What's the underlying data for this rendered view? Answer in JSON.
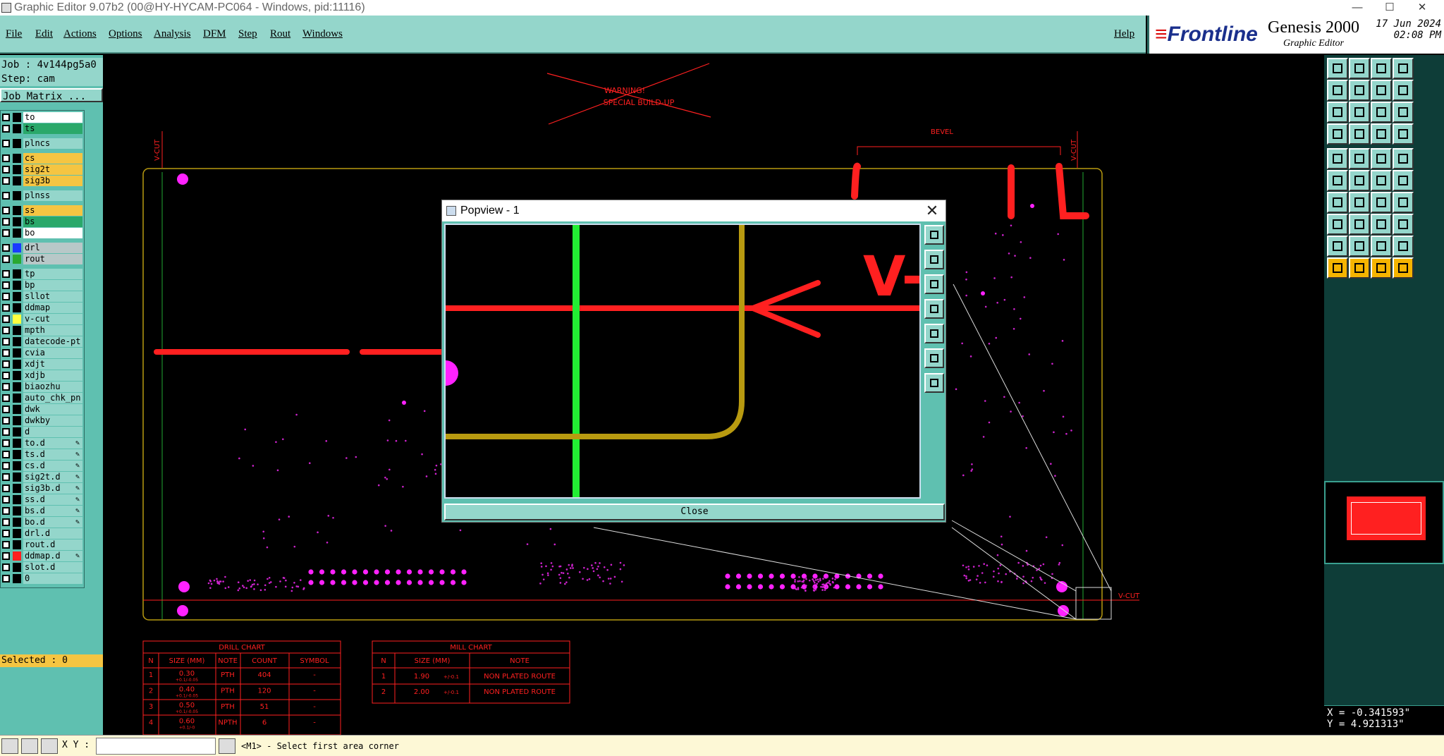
{
  "window": {
    "title": "Graphic Editor 9.07b2 (00@HY-HYCAM-PC064 - Windows, pid:11116)",
    "min": "—",
    "max": "☐",
    "close": "✕"
  },
  "menu": [
    "File",
    "Edit",
    "Actions",
    "Options",
    "Analysis",
    "DFM",
    "Step",
    "Rout",
    "Windows"
  ],
  "help": "Help",
  "brand": {
    "logo_pre": "≡",
    "logo": "Frontline",
    "product": "Genesis 2000",
    "subtitle": "Graphic Editor",
    "date": "17 Jun 2024",
    "time": "02:08 PM"
  },
  "job": {
    "job": "Job : 4v144pg5a0",
    "step": "Step: cam",
    "matrix": "Job Matrix ..."
  },
  "layers": [
    {
      "name": "to",
      "bg": "#ffffff",
      "sw": "#000000"
    },
    {
      "name": "ts",
      "bg": "#2aa86a",
      "sw": "#000000"
    },
    {
      "name": "plncs",
      "bg": "#94d6cb",
      "sw": "#000000"
    },
    {
      "name": "cs",
      "bg": "#f5c542",
      "sw": "#000000"
    },
    {
      "name": "sig2t",
      "bg": "#f5c542",
      "sw": "#000000"
    },
    {
      "name": "sig3b",
      "bg": "#f5c542",
      "sw": "#000000"
    },
    {
      "name": "plnss",
      "bg": "#94d6cb",
      "sw": "#000000"
    },
    {
      "name": "ss",
      "bg": "#f5c542",
      "sw": "#000000"
    },
    {
      "name": "bs",
      "bg": "#2aa86a",
      "sw": "#000000"
    },
    {
      "name": "bo",
      "bg": "#ffffff",
      "sw": "#000000"
    },
    {
      "name": "drl",
      "bg": "#b8c8c8",
      "sw": "#1a3cff"
    },
    {
      "name": "rout",
      "bg": "#b8c8c8",
      "sw": "#2aa830"
    },
    {
      "name": "tp",
      "bg": "#94d6cb",
      "sw": "#000000"
    },
    {
      "name": "bp",
      "bg": "#94d6cb",
      "sw": "#000000"
    },
    {
      "name": "sllot",
      "bg": "#94d6cb",
      "sw": "#000000"
    },
    {
      "name": "ddmap",
      "bg": "#94d6cb",
      "sw": "#000000"
    },
    {
      "name": "v-cut",
      "bg": "#94d6cb",
      "sw": "#ffff40"
    },
    {
      "name": "mpth",
      "bg": "#94d6cb",
      "sw": "#000000"
    },
    {
      "name": "datecode-pt",
      "bg": "#94d6cb",
      "sw": "#000000"
    },
    {
      "name": "cvia",
      "bg": "#94d6cb",
      "sw": "#000000"
    },
    {
      "name": "xdjt",
      "bg": "#94d6cb",
      "sw": "#000000"
    },
    {
      "name": "xdjb",
      "bg": "#94d6cb",
      "sw": "#000000"
    },
    {
      "name": "biaozhu",
      "bg": "#94d6cb",
      "sw": "#000000"
    },
    {
      "name": "auto_chk_pn",
      "bg": "#94d6cb",
      "sw": "#000000"
    },
    {
      "name": "dwk",
      "bg": "#94d6cb",
      "sw": "#000000"
    },
    {
      "name": "dwkby",
      "bg": "#94d6cb",
      "sw": "#000000"
    },
    {
      "name": "d",
      "bg": "#94d6cb",
      "sw": "#000000"
    },
    {
      "name": "to.d",
      "bg": "#94d6cb",
      "sw": "#000000",
      "ed": true
    },
    {
      "name": "ts.d",
      "bg": "#94d6cb",
      "sw": "#000000",
      "ed": true
    },
    {
      "name": "cs.d",
      "bg": "#94d6cb",
      "sw": "#000000",
      "ed": true
    },
    {
      "name": "sig2t.d",
      "bg": "#94d6cb",
      "sw": "#000000",
      "ed": true
    },
    {
      "name": "sig3b.d",
      "bg": "#94d6cb",
      "sw": "#000000",
      "ed": true
    },
    {
      "name": "ss.d",
      "bg": "#94d6cb",
      "sw": "#000000",
      "ed": true
    },
    {
      "name": "bs.d",
      "bg": "#94d6cb",
      "sw": "#000000",
      "ed": true
    },
    {
      "name": "bo.d",
      "bg": "#94d6cb",
      "sw": "#000000",
      "ed": true
    },
    {
      "name": "drl.d",
      "bg": "#94d6cb",
      "sw": "#000000"
    },
    {
      "name": "rout.d",
      "bg": "#94d6cb",
      "sw": "#000000"
    },
    {
      "name": "ddmap.d",
      "bg": "#94d6cb",
      "sw": "#ff2020",
      "ed": true
    },
    {
      "name": "slot.d",
      "bg": "#94d6cb",
      "sw": "#000000"
    },
    {
      "name": "0",
      "bg": "#94d6cb",
      "sw": "#000000"
    }
  ],
  "selected": "Selected : 0",
  "canvas": {
    "warning1": "WARNING!",
    "warning2": "SPECIAL BUILD-UP",
    "vcut": "V-CUT",
    "bevel": "BEVEL",
    "drill_chart": {
      "title": "DRILL CHART",
      "headers": [
        "N",
        "SIZE (MM)",
        "NOTE",
        "COUNT",
        "SYMBOL"
      ],
      "rows": [
        [
          "1",
          "0.30",
          "+0.1/-0.05",
          "PTH",
          "404",
          "-"
        ],
        [
          "2",
          "0.40",
          "+0.1/-0.05",
          "PTH",
          "120",
          "-"
        ],
        [
          "3",
          "0.50",
          "+0.1/-0.05",
          "PTH",
          "51",
          "-"
        ],
        [
          "4",
          "0.60",
          "+0.1/-0",
          "NPTH",
          "6",
          "-"
        ]
      ]
    },
    "mill_chart": {
      "title": "MILL CHART",
      "headers": [
        "N",
        "SIZE (MM)",
        "NOTE"
      ],
      "rows": [
        [
          "1",
          "1.90",
          "+/-0.1",
          "NON PLATED ROUTE"
        ],
        [
          "2",
          "2.00",
          "+/-0.1",
          "NON PLATED ROUTE"
        ]
      ]
    }
  },
  "popview": {
    "title": "Popview - 1",
    "close_x": "✕",
    "close_button": "Close",
    "label": "V-"
  },
  "coords": {
    "x": "X = -0.341593\"",
    "y": "Y = 4.921313\""
  },
  "status": {
    "xy_label": "X Y :",
    "xy_value": "",
    "message": "<M1> - Select first area corner"
  },
  "colors": {
    "teal": "#94d6cb",
    "panel": "#5fc0b0",
    "red": "#ff2020",
    "magenta": "#ff22ff",
    "gold": "#b89a10",
    "green": "#22ee33"
  }
}
